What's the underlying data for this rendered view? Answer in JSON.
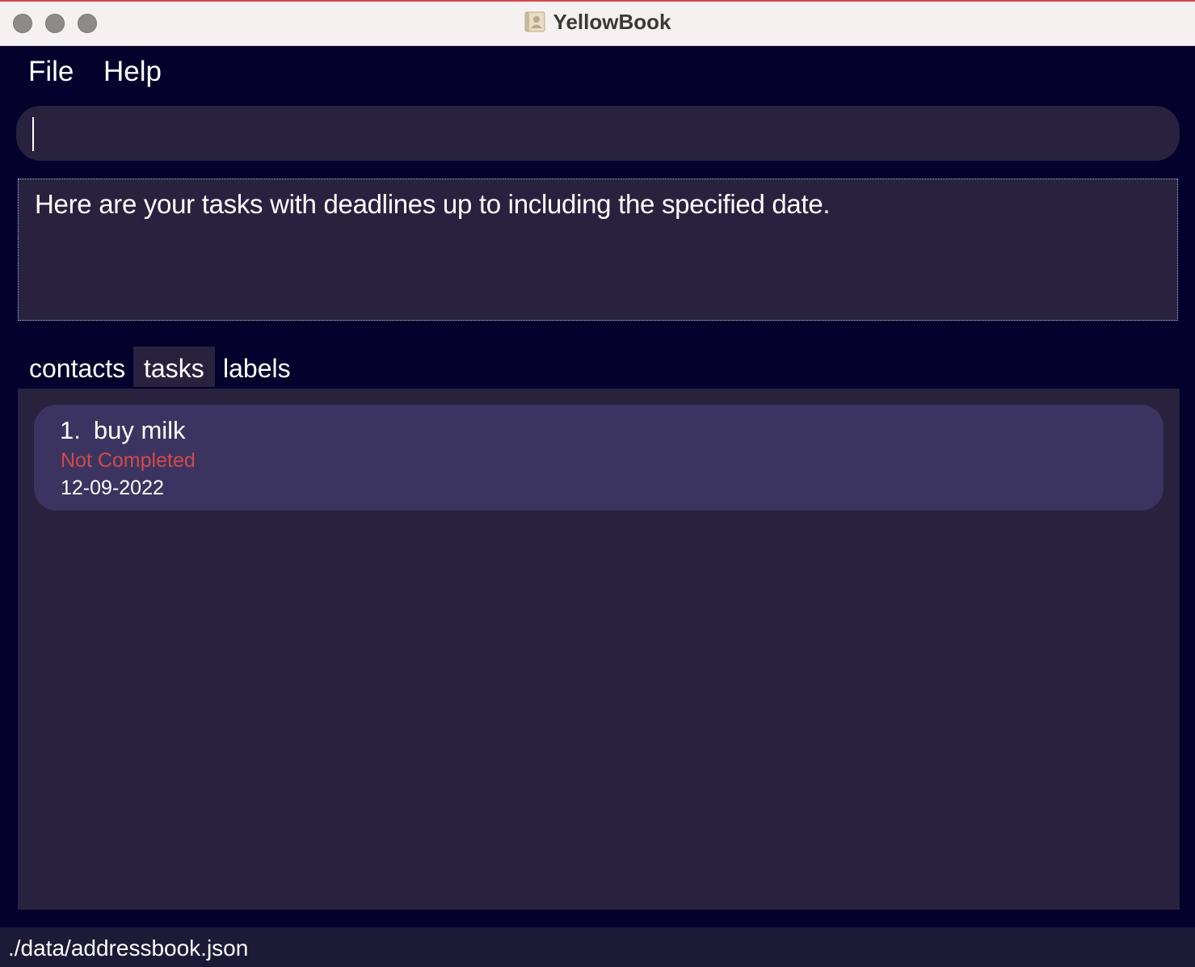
{
  "window": {
    "title": "YellowBook",
    "app_icon": "address-book-icon"
  },
  "menu": {
    "file": "File",
    "help": "Help"
  },
  "command": {
    "value": ""
  },
  "result": {
    "message": "Here are your tasks with deadlines up to including the specified date."
  },
  "tabs": [
    {
      "label": "contacts",
      "active": false
    },
    {
      "label": "tasks",
      "active": true
    },
    {
      "label": "labels",
      "active": false
    }
  ],
  "tasks": [
    {
      "index": "1.",
      "title": "buy milk",
      "status": "Not Completed",
      "deadline": "12-09-2022"
    }
  ],
  "status_bar": {
    "path": "./data/addressbook.json"
  },
  "colors": {
    "background": "#04012c",
    "panel": "#28223f",
    "card": "#3b3460",
    "status_not_completed": "#d24a4a"
  }
}
